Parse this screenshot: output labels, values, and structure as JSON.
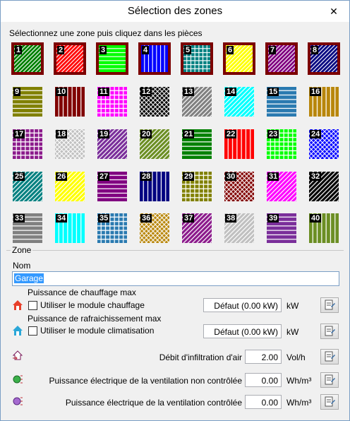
{
  "window": {
    "title": "Sélection des zones",
    "close_glyph": "✕"
  },
  "instruction": "Sélectionnez une zone puis cliquez dans les pièces",
  "zones": [
    {
      "n": "1",
      "color": "#008000",
      "pattern": "diag",
      "line": "#ffffff",
      "frame": true
    },
    {
      "n": "2",
      "color": "#ff0000",
      "pattern": "diag",
      "line": "#ffffff",
      "frame": true
    },
    {
      "n": "3",
      "color": "#00ff00",
      "pattern": "hlines",
      "line": "#ffffff",
      "frame": true
    },
    {
      "n": "4",
      "color": "#0000ff",
      "pattern": "vlines",
      "line": "#ffffff",
      "frame": true
    },
    {
      "n": "5",
      "color": "#008080",
      "pattern": "grid",
      "line": "#ffffff",
      "frame": true
    },
    {
      "n": "6",
      "color": "#ffff00",
      "pattern": "diag",
      "line": "#ffffff",
      "frame": true
    },
    {
      "n": "7",
      "color": "#800080",
      "pattern": "diag",
      "line": "#ffffff",
      "frame": true
    },
    {
      "n": "8",
      "color": "#000080",
      "pattern": "diag",
      "line": "#ffffff",
      "frame": true
    },
    {
      "n": "9",
      "color": "#808000",
      "pattern": "hlines",
      "line": "#ffffff",
      "frame": false
    },
    {
      "n": "10",
      "color": "#800000",
      "pattern": "vlines",
      "line": "#ffffff",
      "frame": false
    },
    {
      "n": "11",
      "color": "#ff00ff",
      "pattern": "grid",
      "line": "#ffffff",
      "frame": false
    },
    {
      "n": "12",
      "color": "#000000",
      "pattern": "cross",
      "line": "#ffffff",
      "frame": false
    },
    {
      "n": "13",
      "color": "#808080",
      "pattern": "diag",
      "line": "#ffffff",
      "frame": false
    },
    {
      "n": "14",
      "color": "#00ffff",
      "pattern": "diag",
      "line": "#ffffff",
      "frame": false
    },
    {
      "n": "15",
      "color": "#2a7ab0",
      "pattern": "hlines",
      "line": "#ffffff",
      "frame": false
    },
    {
      "n": "16",
      "color": "#b8860b",
      "pattern": "vlines",
      "line": "#ffffff",
      "frame": false
    },
    {
      "n": "17",
      "color": "#8b1a8b",
      "pattern": "grid",
      "line": "#ffffff",
      "frame": false
    },
    {
      "n": "18",
      "color": "#c0c0c0",
      "pattern": "cross",
      "line": "#ffffff",
      "frame": false
    },
    {
      "n": "19",
      "color": "#7a2e9a",
      "pattern": "diag",
      "line": "#ffffff",
      "frame": false
    },
    {
      "n": "20",
      "color": "#6b8e23",
      "pattern": "diag",
      "line": "#ffffff",
      "frame": false
    },
    {
      "n": "21",
      "color": "#008000",
      "pattern": "hlines",
      "line": "#ffffff",
      "frame": false
    },
    {
      "n": "22",
      "color": "#ff0000",
      "pattern": "vlines",
      "line": "#ffffff",
      "frame": false
    },
    {
      "n": "23",
      "color": "#00ff00",
      "pattern": "grid",
      "line": "#ffffff",
      "frame": false
    },
    {
      "n": "24",
      "color": "#0000ff",
      "pattern": "cross",
      "line": "#ffffff",
      "frame": false
    },
    {
      "n": "25",
      "color": "#008080",
      "pattern": "diag",
      "line": "#ffffff",
      "frame": false
    },
    {
      "n": "26",
      "color": "#ffff00",
      "pattern": "diag",
      "line": "#ffffff",
      "frame": false
    },
    {
      "n": "27",
      "color": "#800080",
      "pattern": "hlines",
      "line": "#ffffff",
      "frame": false
    },
    {
      "n": "28",
      "color": "#000080",
      "pattern": "vlines",
      "line": "#ffffff",
      "frame": false
    },
    {
      "n": "29",
      "color": "#808000",
      "pattern": "grid",
      "line": "#ffffff",
      "frame": false
    },
    {
      "n": "30",
      "color": "#800000",
      "pattern": "cross",
      "line": "#ffffff",
      "frame": false
    },
    {
      "n": "31",
      "color": "#ff00ff",
      "pattern": "diag",
      "line": "#ffffff",
      "frame": false
    },
    {
      "n": "32",
      "color": "#000000",
      "pattern": "diag",
      "line": "#ffffff",
      "frame": false
    },
    {
      "n": "33",
      "color": "#808080",
      "pattern": "hlines",
      "line": "#ffffff",
      "frame": false
    },
    {
      "n": "34",
      "color": "#00ffff",
      "pattern": "vlines",
      "line": "#ffffff",
      "frame": false
    },
    {
      "n": "35",
      "color": "#2a7ab0",
      "pattern": "grid",
      "line": "#ffffff",
      "frame": false
    },
    {
      "n": "36",
      "color": "#b8860b",
      "pattern": "cross",
      "line": "#ffffff",
      "frame": false
    },
    {
      "n": "37",
      "color": "#8b1a8b",
      "pattern": "diag",
      "line": "#ffffff",
      "frame": false
    },
    {
      "n": "38",
      "color": "#c0c0c0",
      "pattern": "diag",
      "line": "#ffffff",
      "frame": false
    },
    {
      "n": "39",
      "color": "#7a2e9a",
      "pattern": "hlines",
      "line": "#ffffff",
      "frame": false
    },
    {
      "n": "40",
      "color": "#6b8e23",
      "pattern": "vlines",
      "line": "#ffffff",
      "frame": false
    }
  ],
  "zone_group": {
    "label": "Zone",
    "nom_label": "Nom",
    "nom_value": "Garage",
    "chauffage": {
      "title": "Puissance de chauffage max",
      "checkbox_label": "Utiliser le module chauffage",
      "value": "Défaut (0.00 kW)",
      "unit": "kW"
    },
    "refroid": {
      "title": "Puissance de rafraichissement max",
      "checkbox_label": "Utiliser le module climatisation",
      "value": "Défaut (0.00 kW)",
      "unit": "kW"
    },
    "infiltration": {
      "label": "Débit d'infiltration d'air",
      "value": "2.00",
      "unit": "Vol/h"
    },
    "vent_nc": {
      "label": "Puissance électrique de la ventilation non contrôlée",
      "value": "0.00",
      "unit": "Wh/m³"
    },
    "vent_c": {
      "label": "Puissance électrique de la ventilation contrôlée",
      "value": "0.00",
      "unit": "Wh/m³"
    }
  }
}
